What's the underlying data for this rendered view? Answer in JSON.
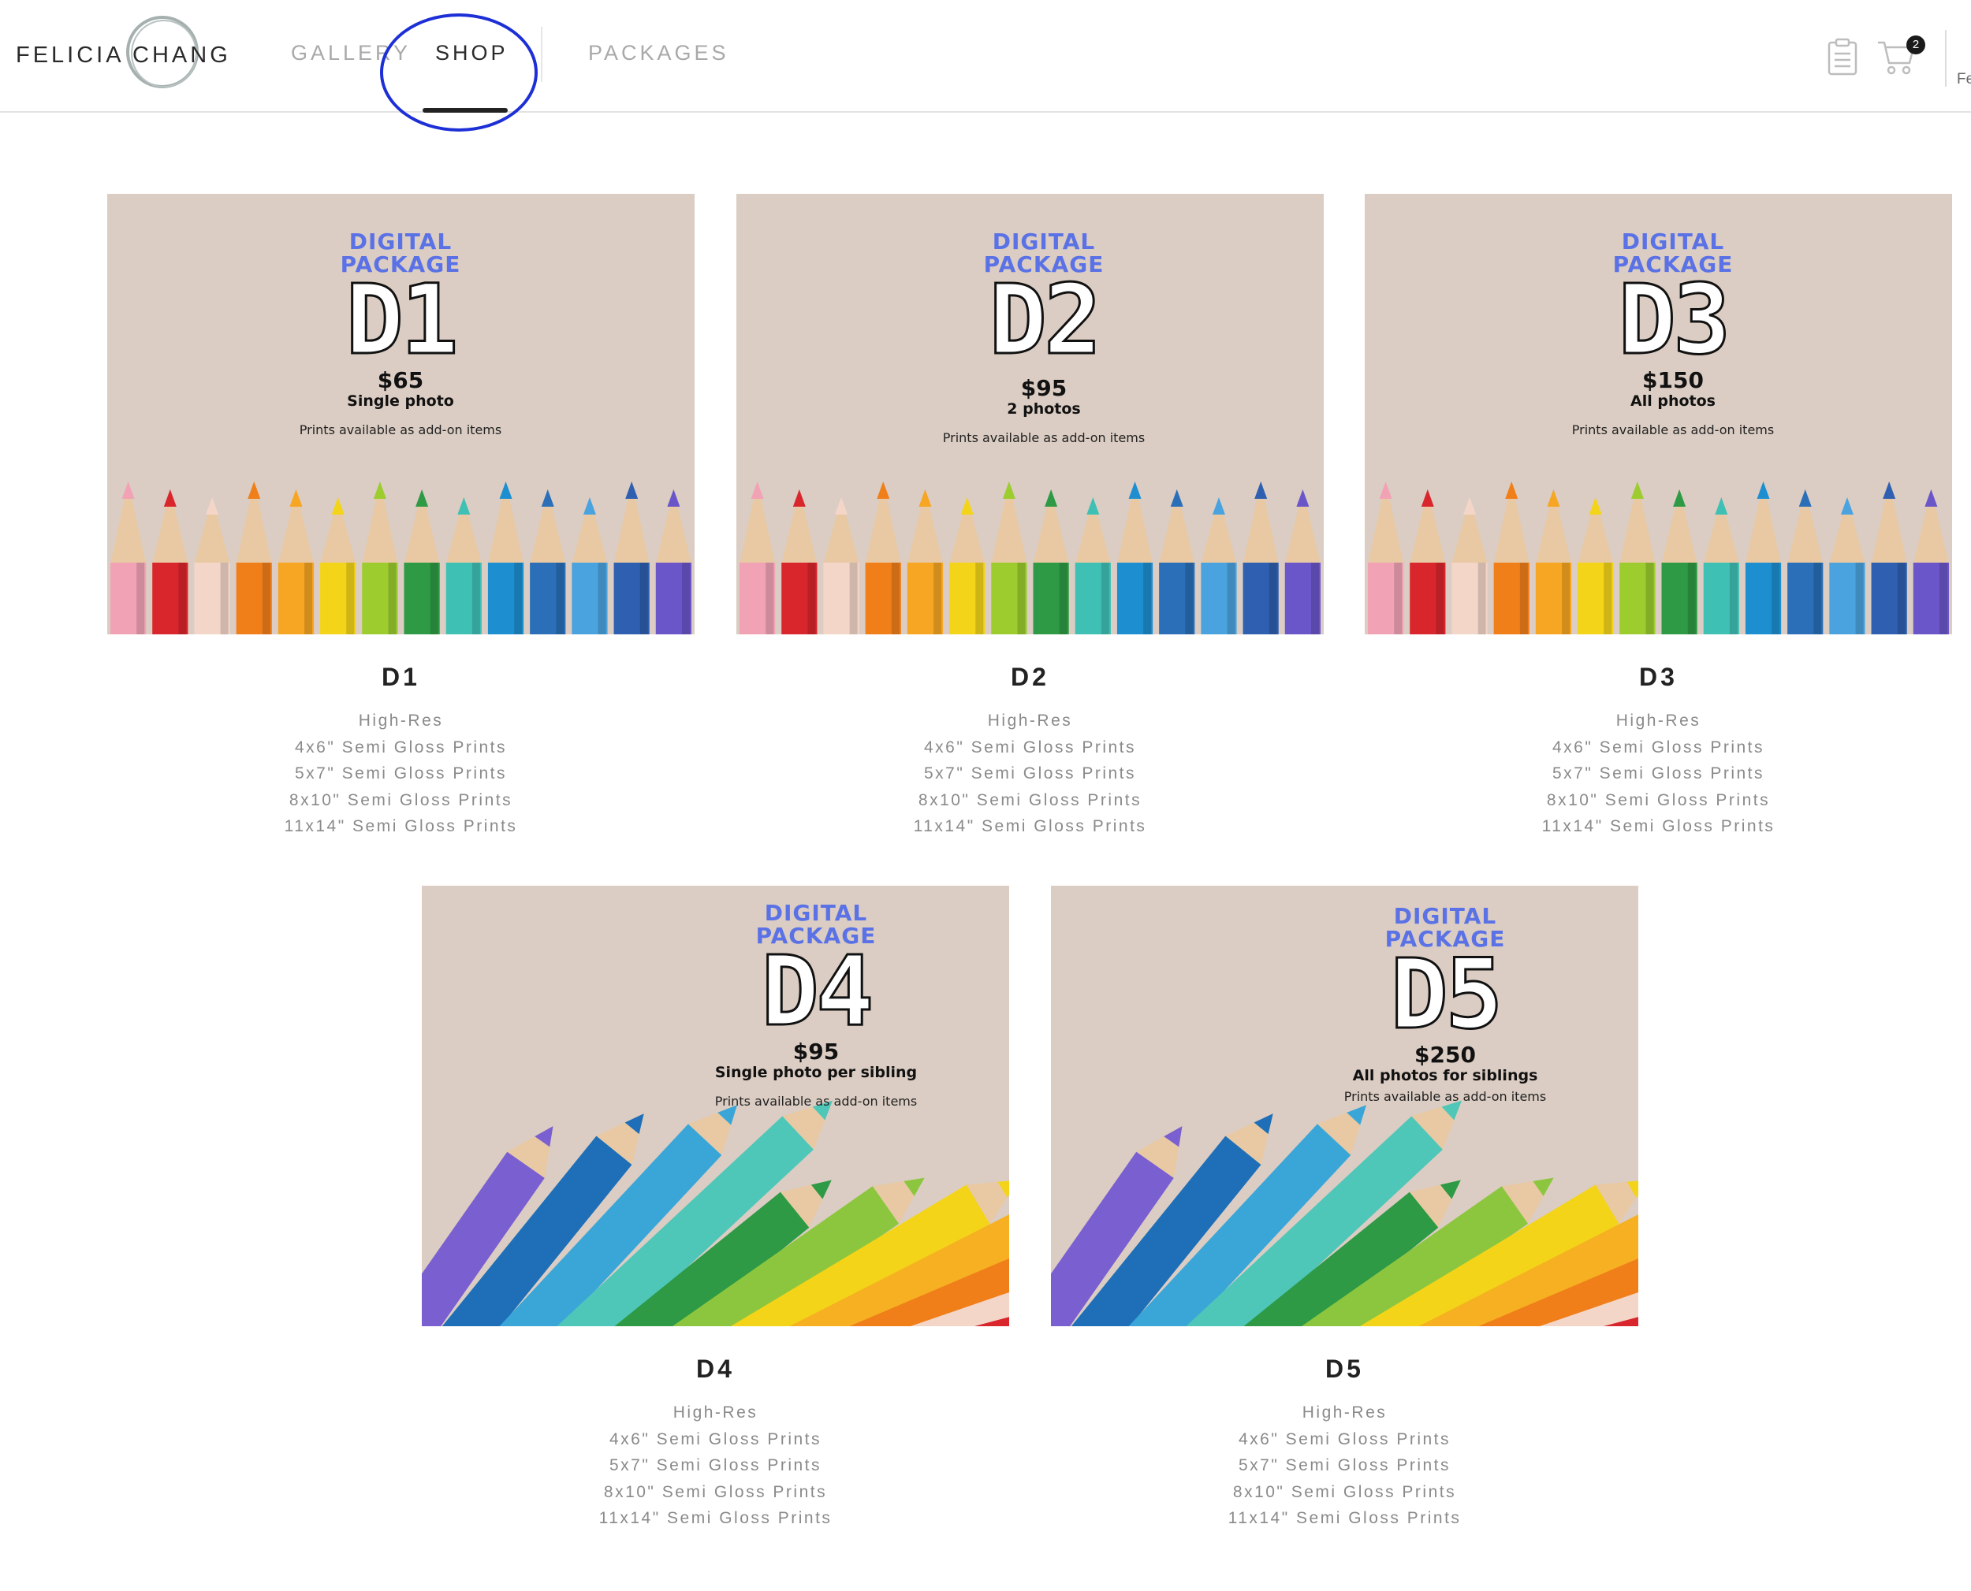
{
  "header": {
    "logo_text": "FELICIA CHANG",
    "nav": [
      {
        "label": "GALLERY"
      },
      {
        "label": "SHOP"
      },
      {
        "label": "PACKAGES"
      }
    ],
    "cart_count": "2",
    "cut_text": "Fe"
  },
  "colors": {
    "accent_blue": "#5a72e6",
    "annotation": "#1d2fd6",
    "image_bg": "#dbcdc3"
  },
  "packages": [
    {
      "code": "D1",
      "heading_1": "DIGITAL",
      "heading_2": "PACKAGE",
      "price": "$65",
      "desc": "Single photo",
      "note": "Prints available as add-on items",
      "title": "D1",
      "options": [
        "High-Res",
        "4x6\" Semi Gloss Prints",
        "5x7\" Semi Gloss Prints",
        "8x10\" Semi Gloss Prints",
        "11x14\" Semi Gloss Prints"
      ]
    },
    {
      "code": "D2",
      "heading_1": "DIGITAL",
      "heading_2": "PACKAGE",
      "price": "$95",
      "desc": "2 photos",
      "note": "Prints available as add-on items",
      "title": "D2",
      "options": [
        "High-Res",
        "4x6\" Semi Gloss Prints",
        "5x7\" Semi Gloss Prints",
        "8x10\" Semi Gloss Prints",
        "11x14\" Semi Gloss Prints"
      ]
    },
    {
      "code": "D3",
      "heading_1": "DIGITAL",
      "heading_2": "PACKAGE",
      "price": "$150",
      "desc": "All photos",
      "note": "Prints available as add-on items",
      "title": "D3",
      "options": [
        "High-Res",
        "4x6\" Semi Gloss Prints",
        "5x7\" Semi Gloss Prints",
        "8x10\" Semi Gloss Prints",
        "11x14\" Semi Gloss Prints"
      ]
    },
    {
      "code": "D4",
      "heading_1": "DIGITAL",
      "heading_2": "PACKAGE",
      "price": "$95",
      "desc": "Single photo per sibling",
      "note": "Prints available as add-on items",
      "title": "D4",
      "options": [
        "High-Res",
        "4x6\" Semi Gloss Prints",
        "5x7\" Semi Gloss Prints",
        "8x10\" Semi Gloss Prints",
        "11x14\" Semi Gloss Prints"
      ]
    },
    {
      "code": "D5",
      "heading_1": "DIGITAL",
      "heading_2": "PACKAGE",
      "price": "$250",
      "desc": "All photos for siblings",
      "note": "Prints available as add-on items",
      "title": "D5",
      "options": [
        "High-Res",
        "4x6\" Semi Gloss Prints",
        "5x7\" Semi Gloss Prints",
        "8x10\" Semi Gloss Prints",
        "11x14\" Semi Gloss Prints"
      ]
    }
  ]
}
